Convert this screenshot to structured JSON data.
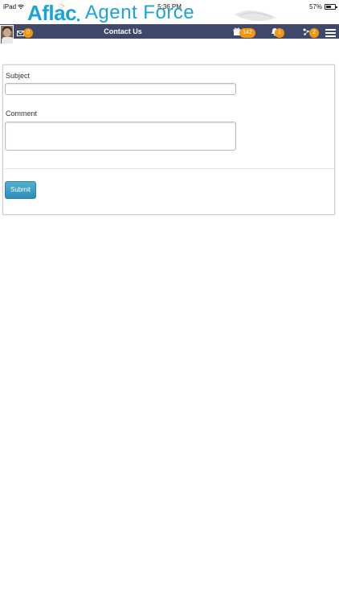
{
  "status_bar": {
    "device": "iPad",
    "time": "5:36 PM",
    "battery": "57%"
  },
  "brand": {
    "logo_left": "Aflac",
    "logo_right": "Agent Force"
  },
  "nav": {
    "title": "Contact Us",
    "mail_count": "0",
    "notifications_count": "142",
    "alerts_count": "1",
    "tasks_count": "2"
  },
  "form": {
    "subject_label": "Subject",
    "subject_value": "",
    "comment_label": "Comment",
    "comment_value": "",
    "submit_label": "Submit"
  },
  "colors": {
    "nav_bg": "#3f4869",
    "badge": "#f0960f",
    "brand": "#1aa3d6",
    "button": "#3a9dc2"
  }
}
